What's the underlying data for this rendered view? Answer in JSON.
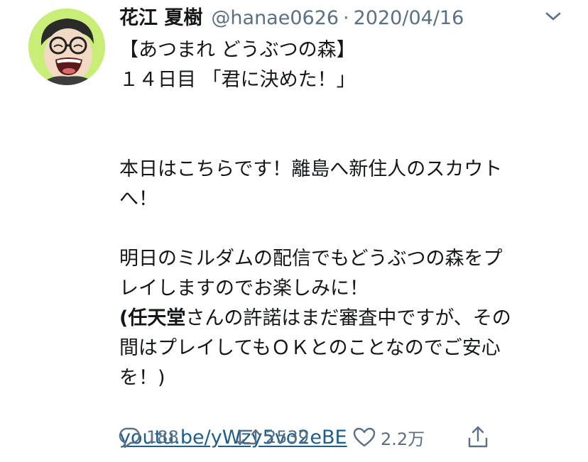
{
  "user": {
    "display_name": "花江 夏樹",
    "handle": "@hanae0626",
    "separator": "·",
    "date": "2020/04/16",
    "avatar_icon": "avatar-photo"
  },
  "menu_icon": "chevron-down-icon",
  "tweet": {
    "line1": "【あつまれ どうぶつの森】",
    "line2": "１４日目 「君に決めた！」",
    "line3": "本日はこちらです！離島へ新住人のスカウト",
    "line4": "へ！",
    "line5": "明日のミルダムの配信でもどうぶつの森をプ",
    "line6": "レイしますのでお楽しみに！",
    "line7_prefix": "(",
    "line7_bold": "任天堂",
    "line7_rest": "さんの許諾はまだ審査中ですが、その",
    "line8": "間はプレイしてもＯＫとのことなのでご安心",
    "line9": "を！)",
    "link": "youtu.be/yWzy5vo2eBE"
  },
  "stats": {
    "replies": "188",
    "retweets": "2539",
    "likes": "2.2万"
  },
  "colors": {
    "text": "#14171a",
    "secondary": "#5b7083",
    "link": "#1b5e8c",
    "avatar_bg": "#c9ee7a"
  }
}
